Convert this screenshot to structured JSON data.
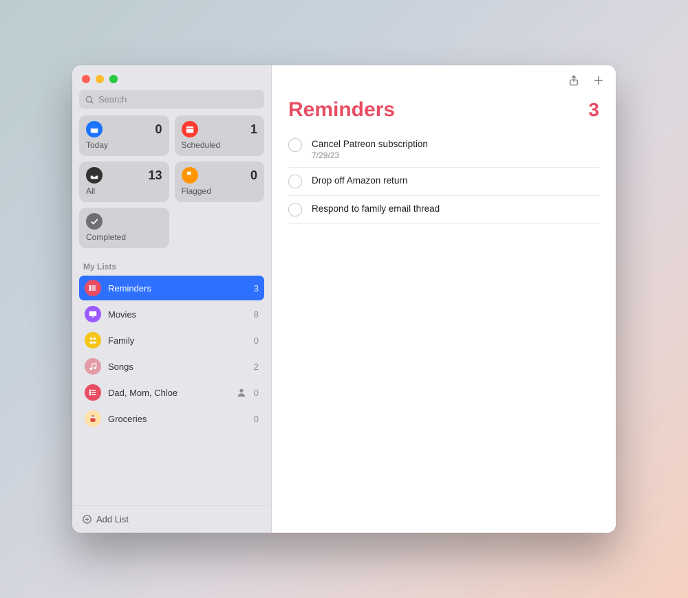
{
  "colors": {
    "accent_pink": "#e84d63",
    "select_blue": "#2e70ff"
  },
  "search": {
    "placeholder": "Search"
  },
  "smart_lists": {
    "today": {
      "label": "Today",
      "count": "0"
    },
    "scheduled": {
      "label": "Scheduled",
      "count": "1"
    },
    "all": {
      "label": "All",
      "count": "13"
    },
    "flagged": {
      "label": "Flagged",
      "count": "0"
    },
    "completed": {
      "label": "Completed"
    }
  },
  "my_lists_header": "My Lists",
  "lists": [
    {
      "name": "Reminders",
      "count": "3",
      "selected": true,
      "icon_bg": "#e84d63",
      "icon": "list"
    },
    {
      "name": "Movies",
      "count": "8",
      "selected": false,
      "icon_bg": "#9b59ff",
      "icon": "display"
    },
    {
      "name": "Family",
      "count": "0",
      "selected": false,
      "icon_bg": "#f5c518",
      "icon": "family"
    },
    {
      "name": "Songs",
      "count": "2",
      "selected": false,
      "icon_bg": "#e39ba6",
      "icon": "music"
    },
    {
      "name": "Dad, Mom, Chloe",
      "count": "0",
      "selected": false,
      "icon_bg": "#e84d63",
      "icon": "list",
      "shared": true
    },
    {
      "name": "Groceries",
      "count": "0",
      "selected": false,
      "icon_bg": "#ffe1a8",
      "icon": "groceries"
    }
  ],
  "add_list_label": "Add List",
  "main": {
    "title": "Reminders",
    "count": "3"
  },
  "tasks": [
    {
      "title": "Cancel Patreon subscription",
      "sub": "7/29/23"
    },
    {
      "title": "Drop off Amazon return"
    },
    {
      "title": "Respond to family email thread"
    }
  ]
}
